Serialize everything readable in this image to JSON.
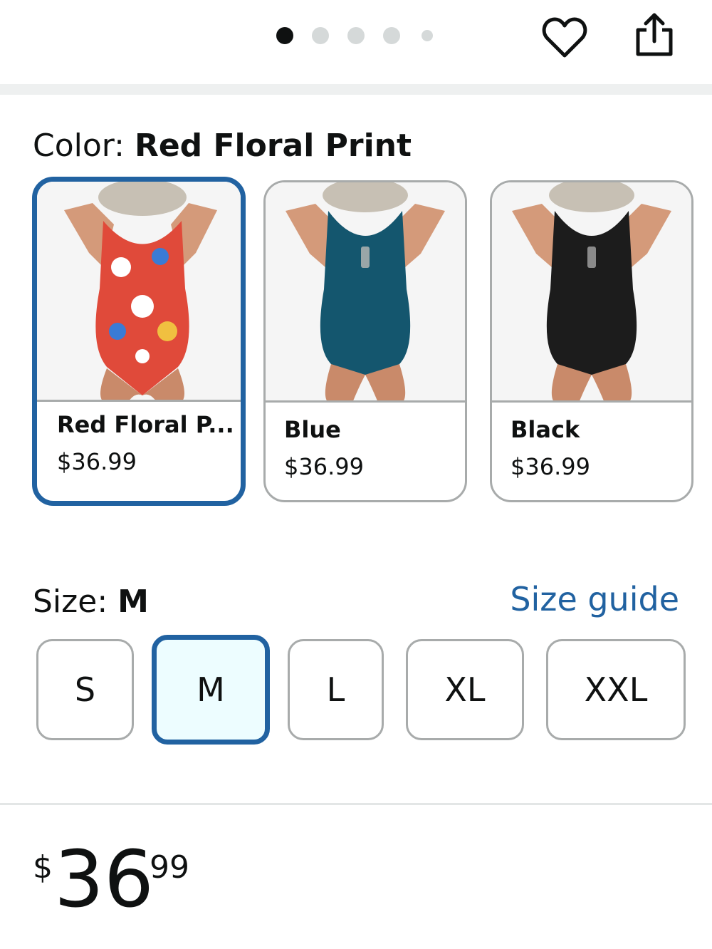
{
  "carousel": {
    "page_count": 5,
    "active_index": 0
  },
  "actions": {
    "wishlist_icon": "heart-icon",
    "share_icon": "share-icon"
  },
  "color": {
    "label": "Color:",
    "selected": "Red Floral Print",
    "options": [
      {
        "name": "Red Floral P...",
        "price": "$36.99",
        "swatch_color": "#e04a3a",
        "selected": true
      },
      {
        "name": "Blue",
        "price": "$36.99",
        "swatch_color": "#14566e",
        "selected": false
      },
      {
        "name": "Black",
        "price": "$36.99",
        "swatch_color": "#1c1c1c",
        "selected": false
      }
    ]
  },
  "size": {
    "label": "Size:",
    "selected": "M",
    "guide_link": "Size guide",
    "options": [
      "S",
      "M",
      "L",
      "XL",
      "XXL"
    ]
  },
  "price": {
    "symbol": "$",
    "whole": "36",
    "fraction": "99"
  },
  "colors": {
    "accent": "#2162a1",
    "selected_bg": "#edfdff",
    "border": "#a8abab"
  }
}
